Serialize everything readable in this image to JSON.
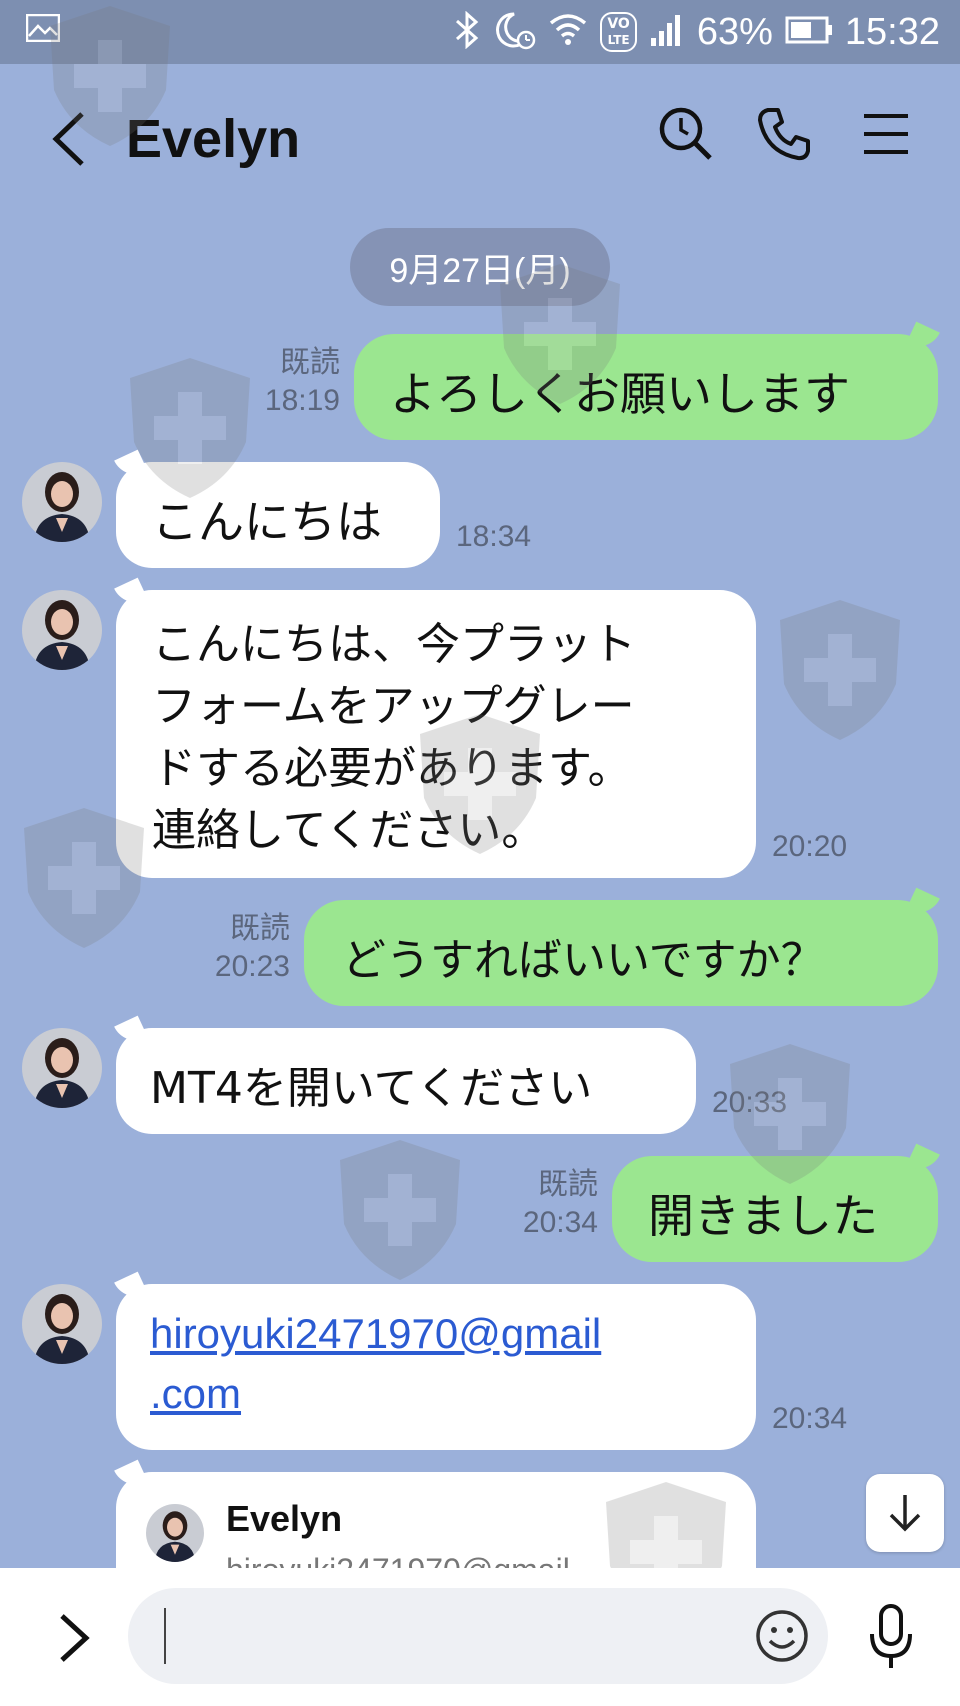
{
  "status_bar": {
    "battery_percent": "63%",
    "time": "15:32",
    "network_badge_top": "VO",
    "network_badge_bottom": "LTE"
  },
  "header": {
    "title": "Evelyn"
  },
  "date_separator": "9月27日(月)",
  "messages": [
    {
      "side": "out",
      "text": "よろしくお願いします",
      "read": "既読",
      "time": "18:19"
    },
    {
      "side": "in",
      "text": "こんにちは",
      "time": "18:34"
    },
    {
      "side": "in",
      "text": "こんにちは、今プラット\nフォームをアップグレー\nドする必要があります。\n連絡してください。",
      "time": "20:20"
    },
    {
      "side": "out",
      "text": "どうすればいいですか？",
      "read": "既読",
      "time": "20:23"
    },
    {
      "side": "in",
      "text": "MT4を開いてください",
      "time": "20:33"
    },
    {
      "side": "out",
      "text": "開きました",
      "read": "既読",
      "time": "20:34"
    },
    {
      "side": "in",
      "text_line1": "hiroyuki2471970@gmail",
      "text_line2": ".com",
      "time": "20:34"
    },
    {
      "side": "in",
      "card_name": "Evelyn",
      "card_partial": "hiroyuki2471970@gmail"
    }
  ],
  "colors": {
    "background": "#9bb0da",
    "status_bar": "#7d8fb1",
    "outgoing_bubble": "#9be690",
    "incoming_bubble": "#ffffff",
    "link": "#2b5bd2"
  },
  "icons": {
    "back": "chevron-left-icon",
    "search": "search-icon",
    "call": "phone-icon",
    "menu": "menu-icon",
    "scroll_down": "arrow-down-icon",
    "expand": "chevron-right-icon",
    "emoji": "emoji-icon",
    "mic": "microphone-icon"
  }
}
